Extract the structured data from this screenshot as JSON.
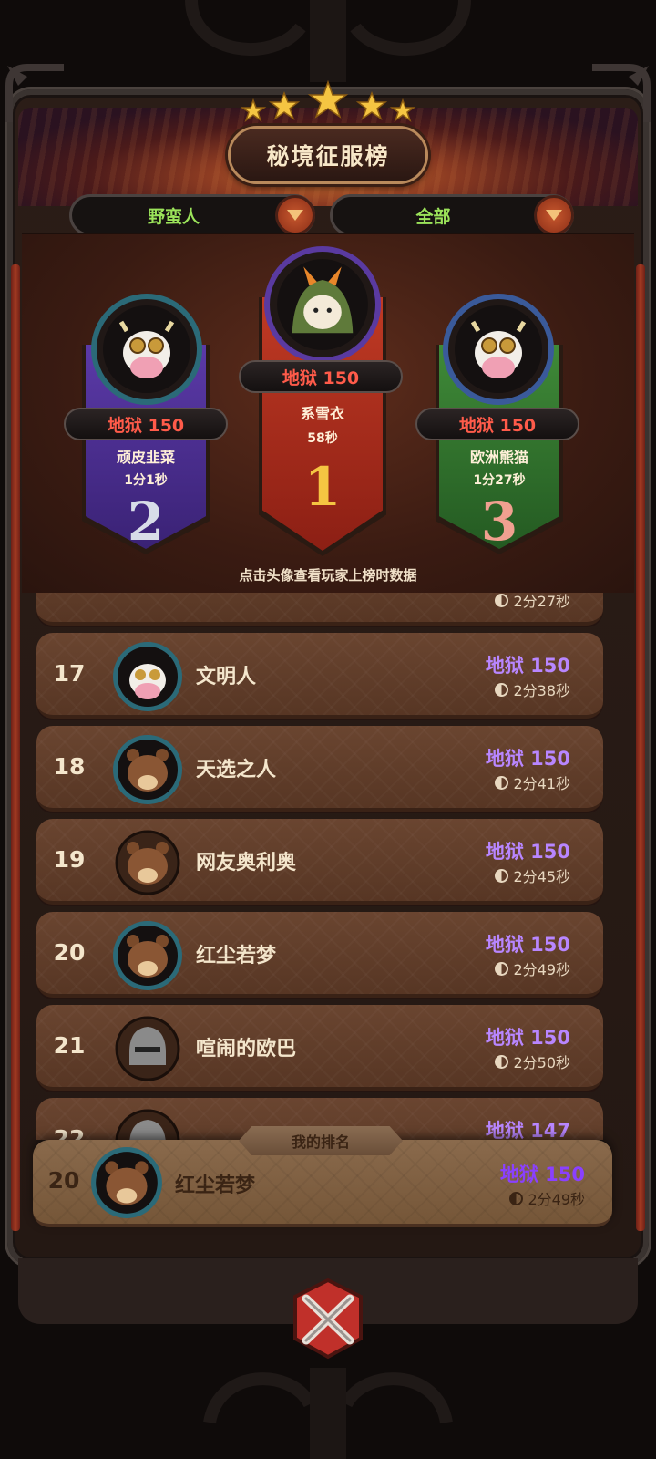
{
  "title": "秘境征服榜",
  "filters": {
    "class_label": "野蛮人",
    "scope_label": "全部"
  },
  "podium": [
    {
      "rank": "2",
      "mode": "地狱 150",
      "name": "顽皮韭菜",
      "time": "1分1秒",
      "avatar": "cow-mask-avatar"
    },
    {
      "rank": "1",
      "mode": "地狱 150",
      "name": "系雪衣",
      "time": "58秒",
      "avatar": "fox-hood-avatar"
    },
    {
      "rank": "3",
      "mode": "地狱 150",
      "name": "欧洲熊猫",
      "time": "1分27秒",
      "avatar": "cow-mask-avatar"
    }
  ],
  "tip": "点击头像查看玩家上榜时数据",
  "partial_top_row": {
    "time": "2分27秒"
  },
  "rows": [
    {
      "rank": "17",
      "name": "文明人",
      "mode": "地狱 150",
      "time": "2分38秒",
      "avatar": "cow-mask-avatar"
    },
    {
      "rank": "18",
      "name": "天选之人",
      "mode": "地狱 150",
      "time": "2分41秒",
      "avatar": "bear-avatar"
    },
    {
      "rank": "19",
      "name": "网友奥利奥",
      "mode": "地狱 150",
      "time": "2分45秒",
      "avatar": "bear-avatar"
    },
    {
      "rank": "20",
      "name": "红尘若梦",
      "mode": "地狱 150",
      "time": "2分49秒",
      "avatar": "bear-avatar"
    },
    {
      "rank": "21",
      "name": "喧闹的欧巴",
      "mode": "地狱 150",
      "time": "2分50秒",
      "avatar": "knight-avatar"
    },
    {
      "rank": "22",
      "name": "",
      "mode": "地狱 147",
      "time": "",
      "avatar": "knight-avatar"
    }
  ],
  "my_rank": {
    "tag": "我的排名",
    "rank": "20",
    "name": "红尘若梦",
    "mode": "地狱 150",
    "time": "2分49秒",
    "avatar": "bear-avatar"
  },
  "colors": {
    "mode_text": "#b886ff",
    "podium_mode_text": "#ff5b4a",
    "filter_text": "#9be35a",
    "rank1_ribbon": "#c03a24",
    "rank2_ribbon": "#5b3aa8",
    "rank3_ribbon": "#3f8a38"
  },
  "icons": {
    "close": "close-x-icon",
    "dropdown": "chevron-down-icon",
    "clock": "clock-icon",
    "star": "star-icon"
  }
}
